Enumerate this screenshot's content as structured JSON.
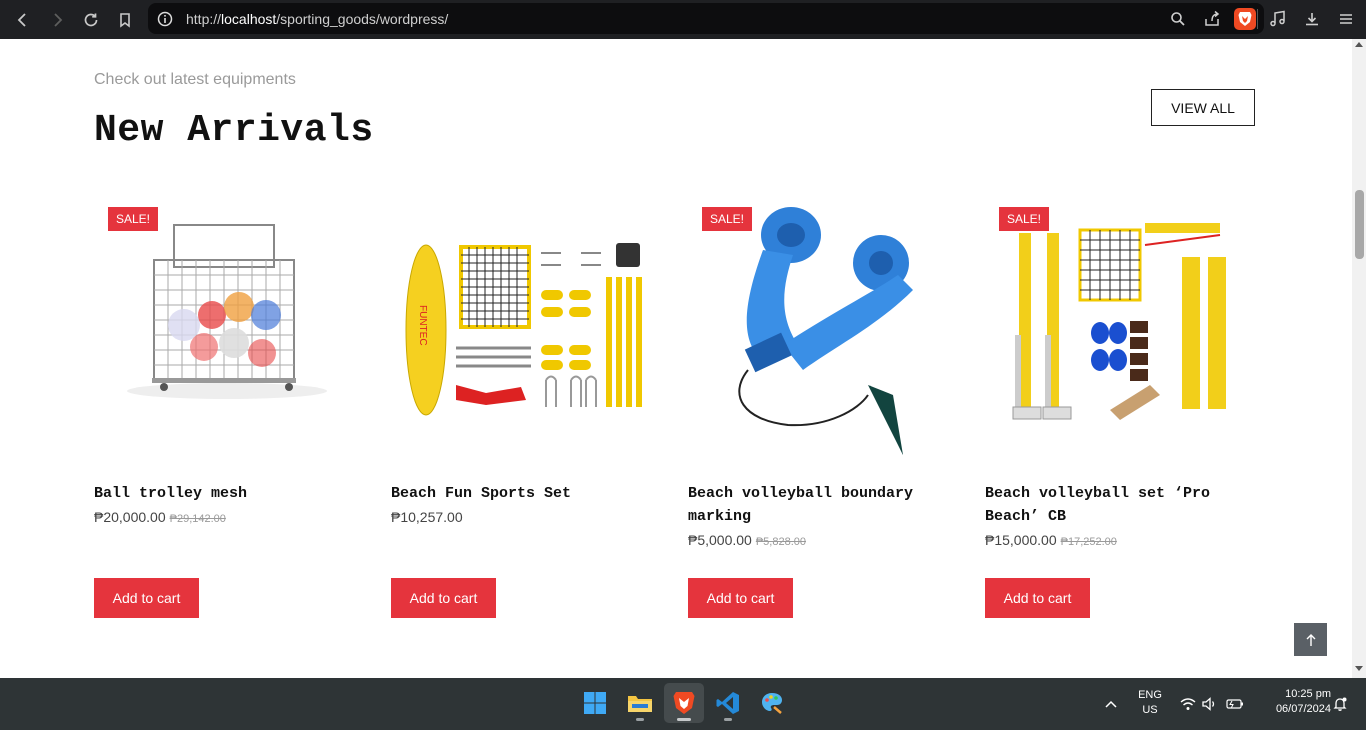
{
  "browser": {
    "url_prefix": "http://",
    "url_host": "localhost",
    "url_path": "/sporting_goods/wordpress/"
  },
  "section": {
    "subtitle": "Check out latest equipments",
    "title": "New Arrivals",
    "view_all_label": "VIEW ALL"
  },
  "products": [
    {
      "name_line1": "Ball trolley mesh",
      "name_line2": "",
      "sale": "SALE!",
      "price": "₱20,000.00",
      "old_price": "₱29,142.00",
      "button": "Add to cart"
    },
    {
      "name_line1": "Beach Fun Sports Set",
      "name_line2": "",
      "sale": "",
      "price": "₱10,257.00",
      "old_price": "",
      "button": "Add to cart"
    },
    {
      "name_line1": "Beach volleyball boundary",
      "name_line2": "marking",
      "sale": "SALE!",
      "price": "₱5,000.00",
      "old_price": "₱5,828.00",
      "button": "Add to cart"
    },
    {
      "name_line1": "Beach volleyball set ‘Pro",
      "name_line2": "Beach’ CB",
      "sale": "SALE!",
      "price": "₱15,000.00",
      "old_price": "₱17,252.00",
      "button": "Add to cart"
    }
  ],
  "taskbar": {
    "lang_line1": "ENG",
    "lang_line2": "US",
    "time": "10:25 pm",
    "date": "06/07/2024"
  },
  "colors": {
    "accent": "#e5343d",
    "browser_bg": "#1f2023",
    "taskbar_bg": "#2e3436"
  }
}
